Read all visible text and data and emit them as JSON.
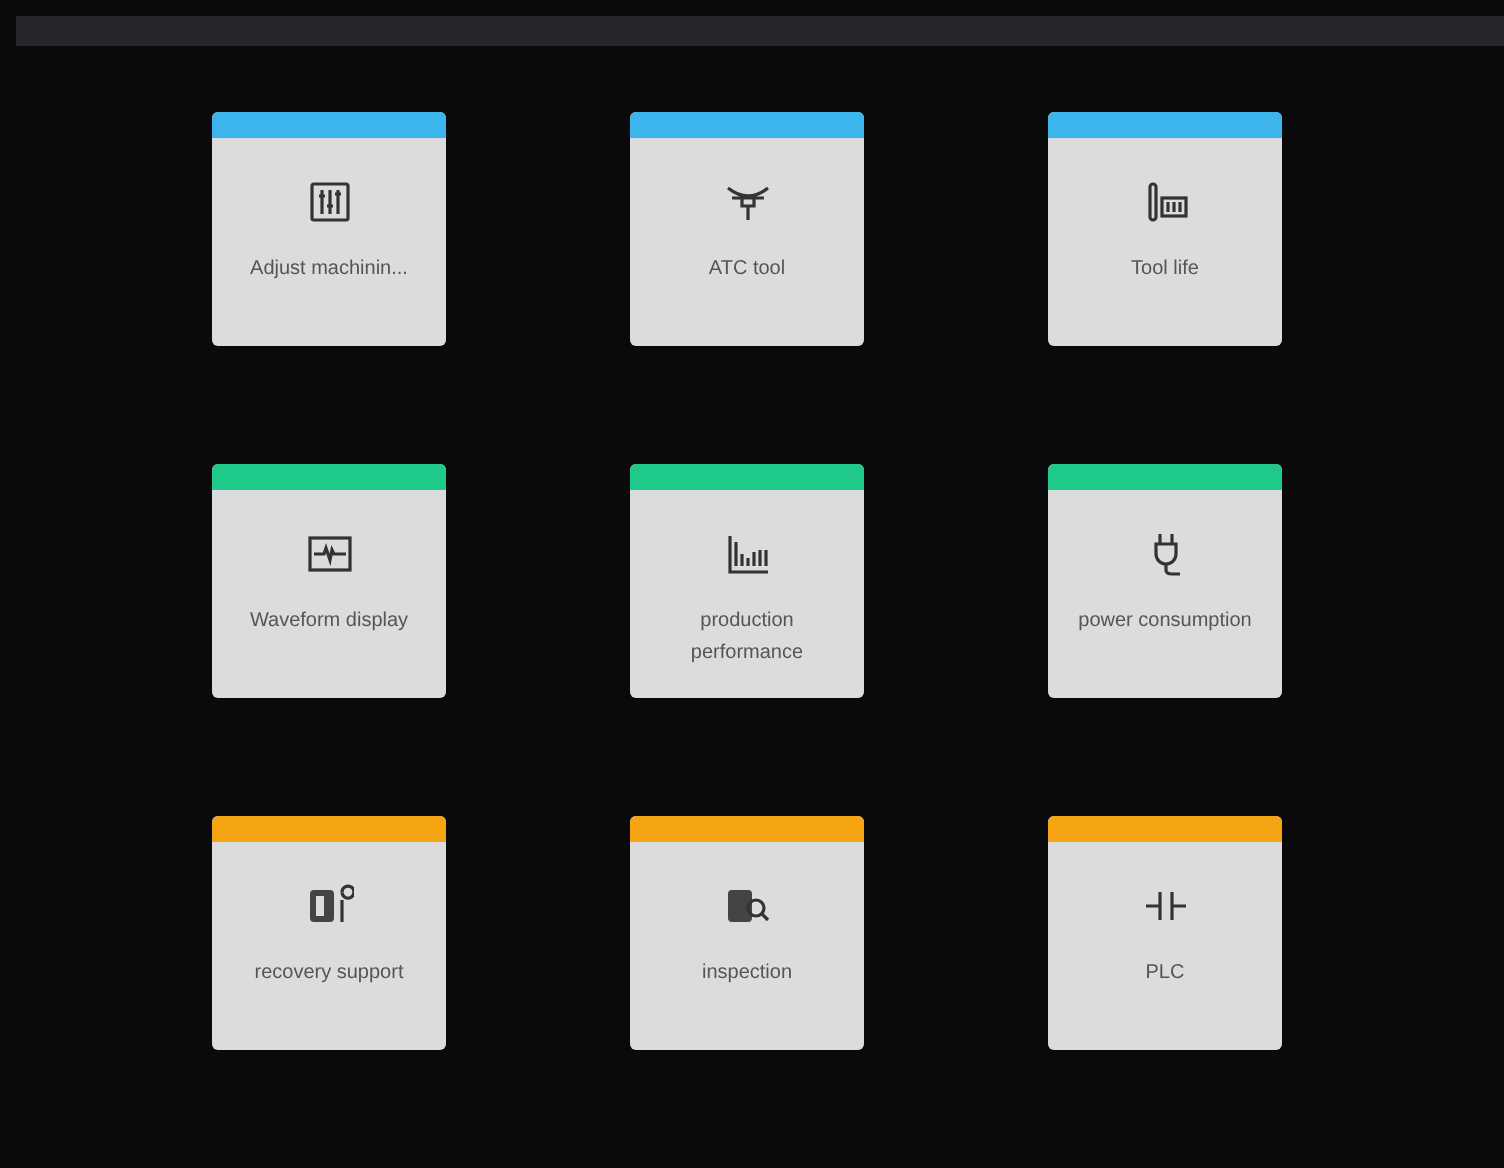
{
  "tiles": [
    {
      "label": "Adjust machinin...",
      "color": "#3cb4ec"
    },
    {
      "label": "ATC tool",
      "color": "#3cb4ec"
    },
    {
      "label": "Tool life",
      "color": "#3cb4ec"
    },
    {
      "label": "Waveform display",
      "color": "#1fc98a"
    },
    {
      "label": "production performance",
      "color": "#1fc98a"
    },
    {
      "label": "power consumption",
      "color": "#1fc98a"
    },
    {
      "label": "recovery support",
      "color": "#f5a511"
    },
    {
      "label": "inspection",
      "color": "#f5a511"
    },
    {
      "label": "PLC",
      "color": "#f5a511"
    }
  ]
}
